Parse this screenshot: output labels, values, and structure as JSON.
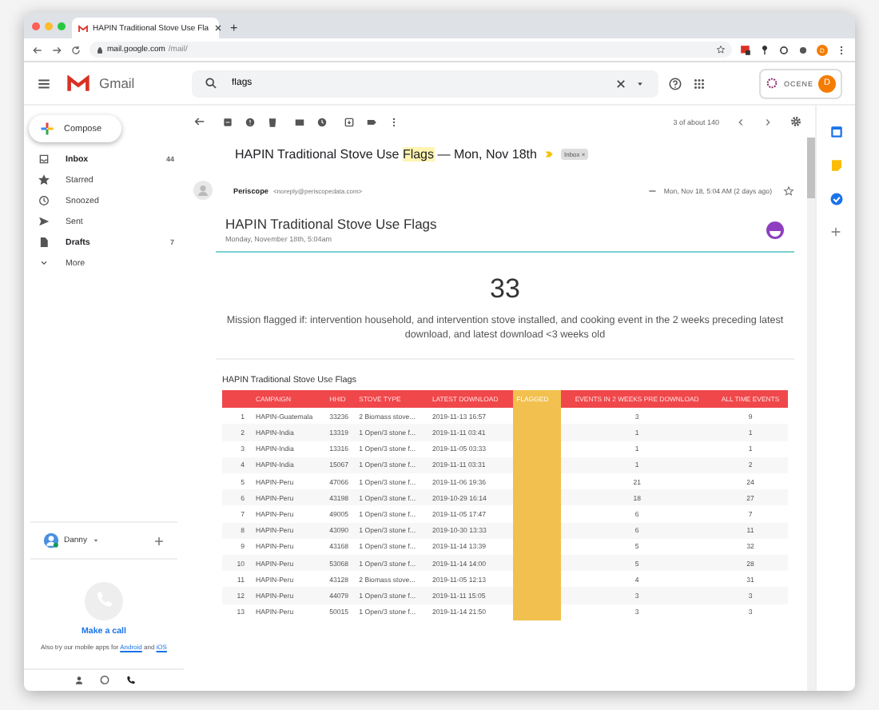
{
  "browser": {
    "tab_title": "HAPIN Traditional Stove Use Fla",
    "new_tab": "+",
    "url_host": "mail.google.com",
    "url_path": "/mail/",
    "profile_initial": "D"
  },
  "header": {
    "logo": "Gmail",
    "search": {
      "value": "flags"
    },
    "org_logo": "OCENE",
    "account_initial": "D"
  },
  "compose": "Compose",
  "sidebar": {
    "items": [
      {
        "kind": "inbox",
        "label": "Inbox",
        "count": "44",
        "bold": true
      },
      {
        "kind": "star",
        "label": "Starred",
        "bold": false
      },
      {
        "kind": "clock",
        "label": "Snoozed",
        "bold": false
      },
      {
        "kind": "send",
        "label": "Sent",
        "bold": false
      },
      {
        "kind": "draft",
        "label": "Drafts",
        "count": "7",
        "bold": true
      },
      {
        "kind": "more",
        "label": "More",
        "bold": false
      }
    ]
  },
  "hangouts": {
    "user": "Danny",
    "call": "Make a call",
    "note": "Also try our mobile apps for",
    "link_1": "Android",
    "joiner": "and",
    "link_2": "iOS"
  },
  "toolbar": {
    "count": "3 of about 140"
  },
  "message": {
    "subject_before": "HAPIN Traditional Stove Use ",
    "subject_highlight": "Flags",
    "subject_after": " — Mon, Nov 18th",
    "label": "Inbox",
    "label_close": "×",
    "sender": "Periscope",
    "email": "<noreply@periscopedata.com>",
    "date": "Mon, Nov 18, 5:04 AM (2 days ago)"
  },
  "report": {
    "title": "HAPIN Traditional Stove Use Flags",
    "subtitle": "Monday, November 18th, 5:04am",
    "big_number": "33",
    "description": "Mission flagged if: intervention household, and intervention stove installed, and cooking event in the 2 weeks preceding latest download, and latest download <3 weeks old",
    "table_title": "HAPIN Traditional Stove Use Flags",
    "columns": [
      "",
      "CAMPAIGN",
      "HHID",
      "STOVE TYPE",
      "LATEST DOWNLOAD",
      "FLAGGED",
      "EVENTS IN 2 WEEKS PRE DOWNLOAD",
      "ALL TIME EVENTS"
    ],
    "rows": [
      {
        "flagged": true,
        "cells": [
          "1",
          "HAPIN-Guatemala",
          "33236",
          "2 Biomass stove...",
          "2019-11-13 16:57",
          "",
          "3",
          "9"
        ]
      },
      {
        "flagged": true,
        "cells": [
          "2",
          "HAPIN-India",
          "13319",
          "1 Open/3 stone f...",
          "2019-11-11 03:41",
          "",
          "1",
          "1"
        ]
      },
      {
        "flagged": true,
        "cells": [
          "3",
          "HAPIN-India",
          "13316",
          "1 Open/3 stone f...",
          "2019-11-05 03:33",
          "",
          "1",
          "1"
        ]
      },
      {
        "flagged": true,
        "cells": [
          "4",
          "HAPIN-India",
          "15067",
          "1 Open/3 stone f...",
          "2019-11-11 03:31",
          "",
          "1",
          "2"
        ]
      },
      {
        "flagged": true,
        "cells": [
          "5",
          "HAPIN-Peru",
          "47066",
          "1 Open/3 stone f...",
          "2019-11-06 19:36",
          "",
          "21",
          "24"
        ]
      },
      {
        "flagged": true,
        "cells": [
          "6",
          "HAPIN-Peru",
          "43198",
          "1 Open/3 stone f...",
          "2019-10-29 16:14",
          "",
          "18",
          "27"
        ]
      },
      {
        "flagged": true,
        "cells": [
          "7",
          "HAPIN-Peru",
          "49005",
          "1 Open/3 stone f...",
          "2019-11-05 17:47",
          "",
          "6",
          "7"
        ]
      },
      {
        "flagged": true,
        "cells": [
          "8",
          "HAPIN-Peru",
          "43090",
          "1 Open/3 stone f...",
          "2019-10-30 13:33",
          "",
          "6",
          "11"
        ]
      },
      {
        "flagged": true,
        "cells": [
          "9",
          "HAPIN-Peru",
          "43168",
          "1 Open/3 stone f...",
          "2019-11-14 13:39",
          "",
          "5",
          "32"
        ]
      },
      {
        "flagged": true,
        "cells": [
          "10",
          "HAPIN-Peru",
          "53068",
          "1 Open/3 stone f...",
          "2019-11-14 14:00",
          "",
          "5",
          "28"
        ]
      },
      {
        "flagged": true,
        "cells": [
          "11",
          "HAPIN-Peru",
          "43128",
          "2 Biomass stove...",
          "2019-11-05 12:13",
          "",
          "4",
          "31"
        ]
      },
      {
        "flagged": true,
        "cells": [
          "12",
          "HAPIN-Peru",
          "44079",
          "1 Open/3 stone f...",
          "2019-11-11 15:05",
          "",
          "3",
          "3"
        ]
      },
      {
        "flagged": true,
        "cells": [
          "13",
          "HAPIN-Peru",
          "50015",
          "1 Open/3 stone f...",
          "2019-11-14 21:50",
          "",
          "3",
          "3"
        ]
      }
    ]
  }
}
